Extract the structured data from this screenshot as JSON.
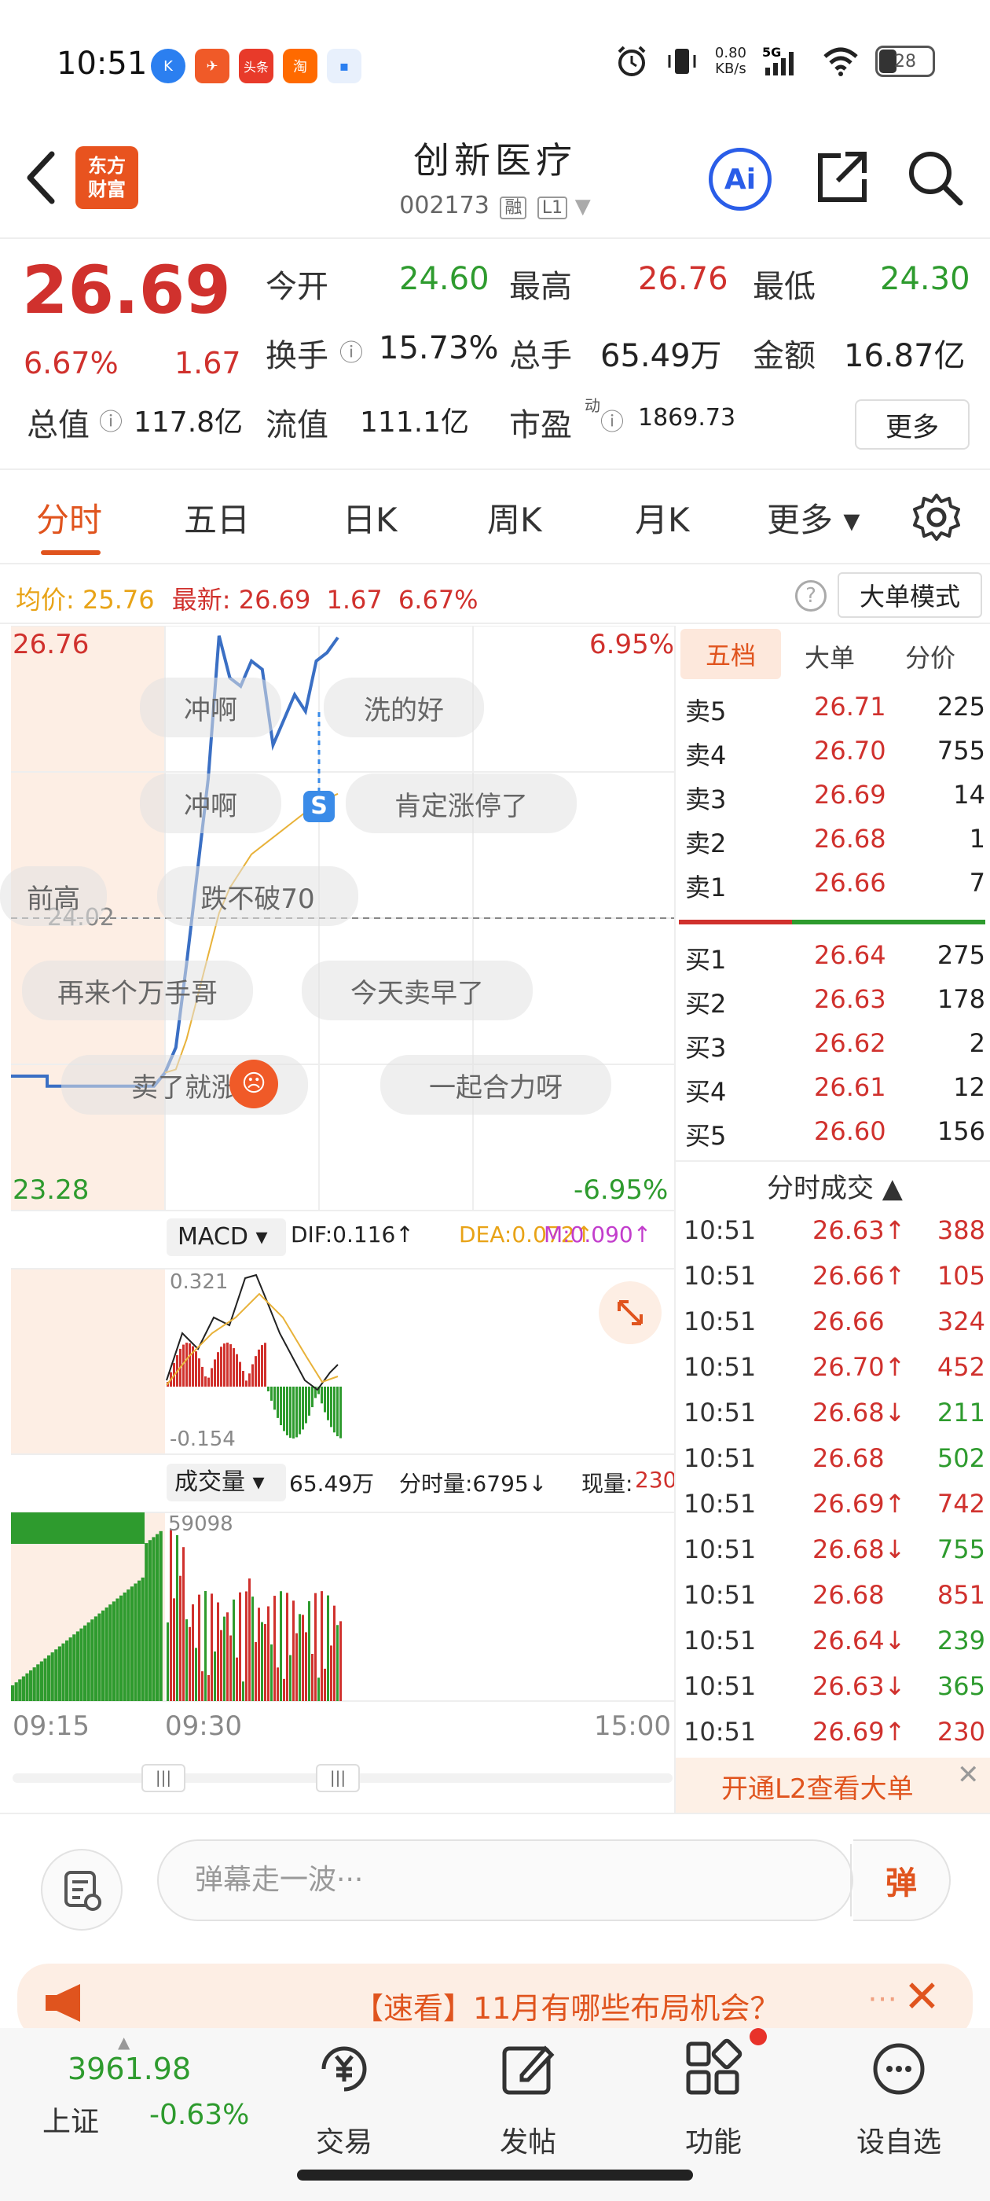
{
  "status_bar": {
    "time": "10:51",
    "apps": [
      "K",
      "✈",
      "头条",
      "淘",
      "▪"
    ],
    "net_speed": "0.80\nKB/s",
    "signal": "5G",
    "battery": "28"
  },
  "header": {
    "logo_text": "东方\n财富",
    "stock_name": "创新医疗",
    "stock_code": "002173",
    "tag_rong": "融",
    "tag_l1": "L1",
    "ai_label": "Ai"
  },
  "quote": {
    "price": "26.69",
    "change_pct": "6.67%",
    "change": "1.67",
    "open_label": "今开",
    "open": "24.60",
    "high_label": "最高",
    "high": "26.76",
    "low_label": "最低",
    "low": "24.30",
    "turnover_label": "换手",
    "turnover": "15.73%",
    "volume_label": "总手",
    "volume": "65.49万",
    "amount_label": "金额",
    "amount": "16.87亿",
    "mktcap_label": "总值",
    "mktcap": "117.8亿",
    "float_label": "流值",
    "float_cap": "111.1亿",
    "pe_label": "市盈",
    "pe_sup": "动",
    "pe": "1869.73",
    "more_label": "更多"
  },
  "tabs": [
    "分时",
    "五日",
    "日K",
    "周K",
    "月K",
    "更多 ▾"
  ],
  "info_line": {
    "avg_label": "均价:",
    "avg": "25.76",
    "latest_label": "最新:",
    "latest": "26.69",
    "chg": "1.67",
    "pct": "6.67%",
    "mode_label": "大单模式"
  },
  "chart": {
    "top_price": "26.76",
    "bottom_price": "23.28",
    "top_pct": "6.95%",
    "bottom_pct": "-6.95%",
    "prev_close_label": "24.02",
    "macd_label": "MACD ▾",
    "dif": "DIF:0.116↑",
    "dea": "DEA:0.072↑",
    "m": "M:0.090↑",
    "macd_top": "0.321",
    "macd_bottom": "-0.154",
    "vol_label": "成交量 ▾",
    "vol_total": "65.49万",
    "vol_min": "分时量:6795↓",
    "vol_now_label": "现量:",
    "vol_now": "230",
    "vol_max": "59098",
    "time_start": "09:15",
    "time_open": "09:30",
    "time_end": "15:00",
    "s_marker": "S",
    "danmu": [
      "冲啊",
      "洗的好",
      "冲啊",
      "肯定涨停了",
      "前高",
      "跌不破70",
      "再来个万手哥",
      "今天卖早了",
      "卖了就涨",
      "一起合力呀"
    ]
  },
  "chart_data": {
    "type": "line",
    "x": [
      "09:30",
      "09:35",
      "09:40",
      "09:45",
      "09:50",
      "09:55",
      "10:00",
      "10:05",
      "10:10",
      "10:15",
      "10:20",
      "10:25",
      "10:30",
      "10:35",
      "10:40",
      "10:45",
      "10:50"
    ],
    "series": [
      {
        "values": [
          24.1,
          24.25,
          24.75,
          25.3,
          25.85,
          26.7,
          26.45,
          26.4,
          26.55,
          26.5,
          26.05,
          26.2,
          26.35,
          26.25,
          26.55,
          26.6,
          26.69
        ]
      },
      {
        "values": [
          24.1,
          24.12,
          24.3,
          24.55,
          24.8,
          25.05,
          25.2,
          25.3,
          25.4,
          25.45,
          25.5,
          25.55,
          25.6,
          25.65,
          25.7,
          25.73,
          25.76
        ]
      }
    ],
    "ylim": [
      23.28,
      26.76
    ]
  },
  "orderbook": {
    "tabs": [
      "五档",
      "大单",
      "分价"
    ],
    "asks": [
      {
        "label": "卖5",
        "price": "26.71",
        "vol": "225"
      },
      {
        "label": "卖4",
        "price": "26.70",
        "vol": "755"
      },
      {
        "label": "卖3",
        "price": "26.69",
        "vol": "14"
      },
      {
        "label": "卖2",
        "price": "26.68",
        "vol": "1"
      },
      {
        "label": "卖1",
        "price": "26.66",
        "vol": "7"
      }
    ],
    "bids": [
      {
        "label": "买1",
        "price": "26.64",
        "vol": "275"
      },
      {
        "label": "买2",
        "price": "26.63",
        "vol": "178"
      },
      {
        "label": "买3",
        "price": "26.62",
        "vol": "2"
      },
      {
        "label": "买4",
        "price": "26.61",
        "vol": "12"
      },
      {
        "label": "买5",
        "price": "26.60",
        "vol": "156"
      }
    ],
    "trades_title": "分时成交 ▲",
    "trades": [
      {
        "time": "10:51",
        "price": "26.63↑",
        "vol": "388",
        "pc": "red",
        "vc": "red"
      },
      {
        "time": "10:51",
        "price": "26.66↑",
        "vol": "105",
        "pc": "red",
        "vc": "red"
      },
      {
        "time": "10:51",
        "price": "26.66",
        "vol": "324",
        "pc": "red",
        "vc": "red"
      },
      {
        "time": "10:51",
        "price": "26.70↑",
        "vol": "452",
        "pc": "red",
        "vc": "red"
      },
      {
        "time": "10:51",
        "price": "26.68↓",
        "vol": "211",
        "pc": "red",
        "vc": "green"
      },
      {
        "time": "10:51",
        "price": "26.68",
        "vol": "502",
        "pc": "red",
        "vc": "green"
      },
      {
        "time": "10:51",
        "price": "26.69↑",
        "vol": "742",
        "pc": "red",
        "vc": "red"
      },
      {
        "time": "10:51",
        "price": "26.68↓",
        "vol": "755",
        "pc": "red",
        "vc": "green"
      },
      {
        "time": "10:51",
        "price": "26.68",
        "vol": "851",
        "pc": "red",
        "vc": "red"
      },
      {
        "time": "10:51",
        "price": "26.64↓",
        "vol": "239",
        "pc": "red",
        "vc": "green"
      },
      {
        "time": "10:51",
        "price": "26.63↓",
        "vol": "365",
        "pc": "red",
        "vc": "green"
      },
      {
        "time": "10:51",
        "price": "26.69↑",
        "vol": "230",
        "pc": "red",
        "vc": "red"
      }
    ],
    "l2_banner": "开通L2查看大单"
  },
  "comment": {
    "placeholder": "弹幕走一波···",
    "send_label": "弹"
  },
  "news": {
    "text": "【速看】11月有哪些布局机会？"
  },
  "bottom_nav": {
    "index_value": "3961.98",
    "index_name": "上证",
    "index_pct": "-0.63%",
    "items": [
      "交易",
      "发帖",
      "功能",
      "设自选"
    ]
  },
  "colors": {
    "up": "#d0312d",
    "down": "#2e9b2e",
    "accent": "#e0541e",
    "price_line": "#3a6fc4",
    "avg_line": "#e8b23a"
  }
}
